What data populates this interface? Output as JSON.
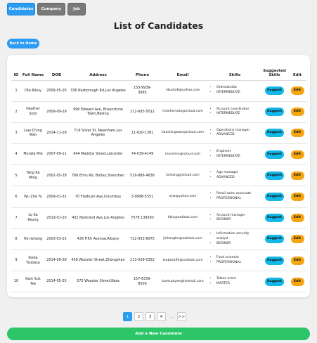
{
  "tabs": [
    {
      "label": "Candidates"
    },
    {
      "label": "Company"
    },
    {
      "label": "Job"
    }
  ],
  "page_title": "List of Candidates",
  "back_button": "Back to Home",
  "table": {
    "headers": [
      "ID",
      "Full Name",
      "DOB",
      "Address",
      "Phone",
      "Email",
      "Skills",
      "Suggested Skills",
      "Edit"
    ],
    "suggest_label": "Suggest",
    "edit_label": "Edit",
    "rows": [
      {
        "id": "1",
        "name": "Ota Rikuy",
        "dob": "2009-05-26",
        "address": "336 Narborough Rd,Los Angeles",
        "phone": "153-9939-3685",
        "email": "rikuota6@yahoo.com",
        "skill1": "Orthodontist",
        "skill2": "INTERMEDIATE"
      },
      {
        "id": "2",
        "name": "Heather Soto",
        "dob": "2009-09-29",
        "address": "996 Edward Ave, Braunstone Town,Beijing",
        "phone": "212-683-5012",
        "email": "heathersoto@icloud.com",
        "skill1": "Account coordinator",
        "skill2": "INTERMEDIATE"
      },
      {
        "id": "3",
        "name": "Liao Ching Wan",
        "dob": "2014-11-28",
        "address": "719 Silver St, Newnham,Los Angeles",
        "phone": "11-620-1381",
        "email": "liaochingwan@icloud.com",
        "skill1": "Operations manager",
        "skill2": "ADVANCED"
      },
      {
        "id": "4",
        "name": "Murata Mio",
        "dob": "2007-09-11",
        "address": "644 Maddox Street,Leicester",
        "phone": "74-039-4149",
        "email": "muramiu@icloud.com",
        "skill1": "Engineer",
        "skill2": "INTERMEDIATE"
      },
      {
        "id": "5",
        "name": "Tang Ka Ming",
        "dob": "2002-05-28",
        "address": "766 Elms Rd, Botley,Shenzhen",
        "phone": "519-866-4636",
        "email": "kmtang@icloud.com",
        "skill1": "Age manager",
        "skill2": "ADVANCED"
      },
      {
        "id": "6",
        "name": "Wu Zhe Yu",
        "dob": "2009-01-31",
        "address": "70 Flatbush Ave,Columbus",
        "phone": "3-9998-5351",
        "email": "zyw@yahoo.com",
        "skill1": "Retail sales associate",
        "skill2": "PROFESSIONAL"
      },
      {
        "id": "7",
        "name": "Lo Ka Keung",
        "dob": "2019-01-20",
        "address": "431 Nostrand Ave,Los Angeles",
        "phone": "7578 139593",
        "email": "kklo@outlook.com",
        "skill1": "Account manager",
        "skill2": "BEGINER"
      },
      {
        "id": "8",
        "name": "He Jiehong",
        "dob": "2003-03-25",
        "address": "436 Fifth Avenue,Albany",
        "phone": "722-933-8975",
        "email": "jiehonghe@outlook.com",
        "skill1": "Information security analyst",
        "skill2": "BEGINER"
      },
      {
        "id": "9",
        "name": "Ikeda Tsubasa",
        "dob": "2014-09-28",
        "address": "458 Wooster Street,Zhongshan",
        "phone": "213-039-0352",
        "email": "tsubasa93@outlook.com",
        "skill1": "Food scientist",
        "skill2": "PROFESSIONAL"
      },
      {
        "id": "10",
        "name": "Kam Suk Yee",
        "dob": "2014-05-25",
        "address": "573 Wooster Street,Nara",
        "phone": "157-6339-8000",
        "email": "kamsukyee@hotmail.com",
        "skill1": "Tattoo artist",
        "skill2": "MASTER"
      }
    ]
  },
  "pagination": {
    "pages": [
      "1",
      "2",
      "3",
      "4"
    ],
    "ellipsis": "...",
    "next": ">>"
  },
  "add_button": "Add a New Candidate",
  "colors": {
    "primary": "#2b9cf2",
    "suggest": "#14b8e8",
    "edit": "#f5a512",
    "add": "#2cc668",
    "tab_inactive": "#7a7a7a"
  }
}
